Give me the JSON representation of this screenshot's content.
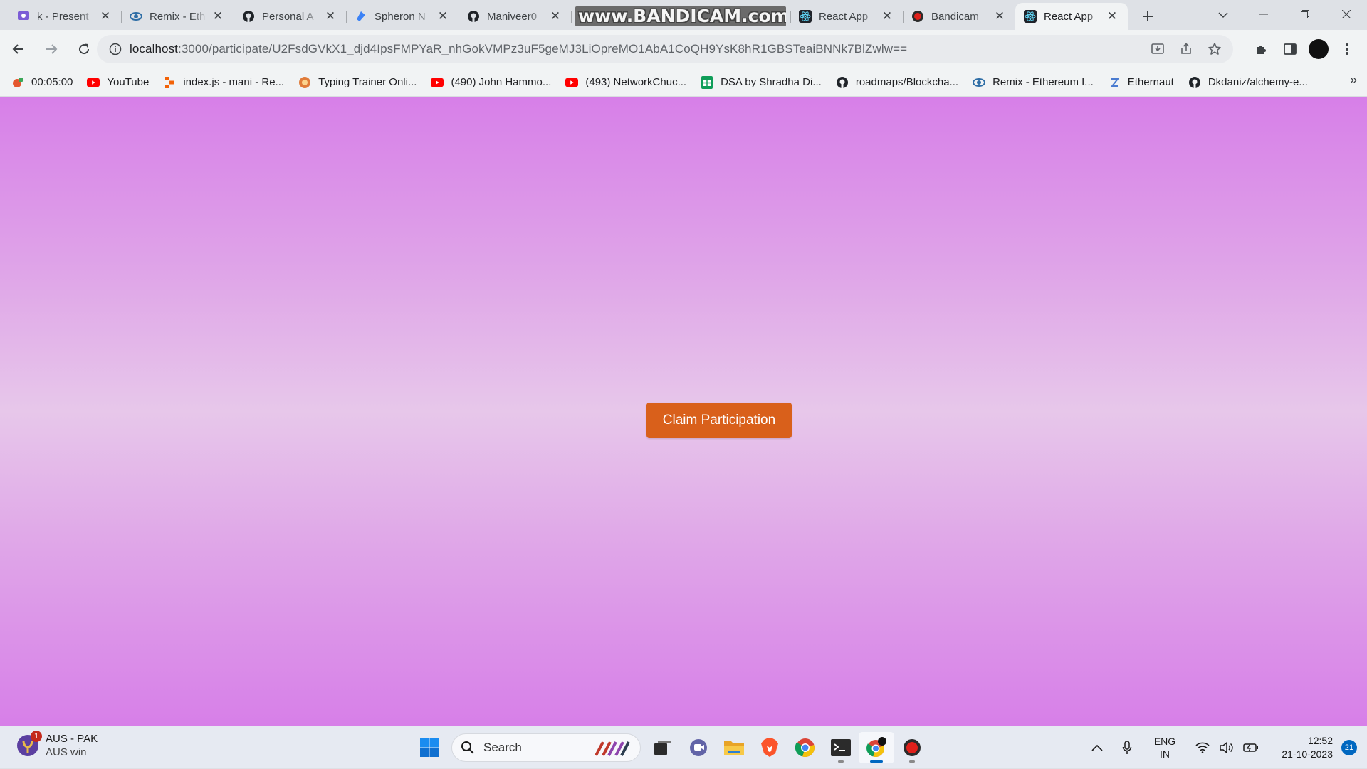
{
  "browser": {
    "tabs": [
      {
        "title": "k - Present",
        "icon": "presentation-app-icon",
        "active": false
      },
      {
        "title": "Remix - Eth",
        "icon": "remix-icon",
        "active": false
      },
      {
        "title": "Personal A",
        "icon": "github-icon",
        "active": false
      },
      {
        "title": "Spheron N",
        "icon": "spheron-icon",
        "active": false
      },
      {
        "title": "Maniveer0",
        "icon": "github-icon",
        "active": false
      },
      {
        "title": "www.BANDICAM.com",
        "icon": "",
        "active": false,
        "watermark": true
      },
      {
        "title": "React App",
        "icon": "react-icon",
        "active": false
      },
      {
        "title": "Bandicam",
        "icon": "bandicam-record-icon",
        "active": false
      },
      {
        "title": "React App",
        "icon": "react-icon",
        "active": true
      }
    ],
    "address": {
      "host": "localhost",
      "path": ":3000/participate/U2FsdGVkX1_djd4IpsFMPYaR_nhGokVMPz3uF5geMJ3LiOpreMO1AbA1CoQH9YsK8hR1GBSTeaiBNNk7BlZwlw=="
    },
    "bookmarks": [
      {
        "label": "00:05:00",
        "icon": "timer-icon"
      },
      {
        "label": "YouTube",
        "icon": "youtube-icon"
      },
      {
        "label": "index.js - mani - Re...",
        "icon": "replit-icon"
      },
      {
        "label": "Typing Trainer Onli...",
        "icon": "typing-trainer-icon"
      },
      {
        "label": "(490) John Hammo...",
        "icon": "youtube-icon"
      },
      {
        "label": "(493) NetworkChuc...",
        "icon": "youtube-icon"
      },
      {
        "label": "DSA by Shradha Di...",
        "icon": "sheets-icon"
      },
      {
        "label": "roadmaps/Blockcha...",
        "icon": "github-icon"
      },
      {
        "label": "Remix - Ethereum I...",
        "icon": "remix-icon"
      },
      {
        "label": "Ethernaut",
        "icon": "ethernaut-icon"
      },
      {
        "label": "Dkdaniz/alchemy-e...",
        "icon": "github-icon"
      }
    ],
    "bookmarks_more": "»"
  },
  "page": {
    "claim_button_label": "Claim Participation",
    "colors": {
      "gradient_edge": "#d77fe8",
      "gradient_center": "#e7c7ea",
      "button": "#d9601b"
    }
  },
  "taskbar": {
    "weather": {
      "line1": "AUS - PAK",
      "line2": "AUS win",
      "badge": "1"
    },
    "search_label": "Search",
    "lang": {
      "line1": "ENG",
      "line2": "IN"
    },
    "clock": {
      "time": "12:52",
      "date": "21-10-2023"
    },
    "notifications": "21"
  }
}
